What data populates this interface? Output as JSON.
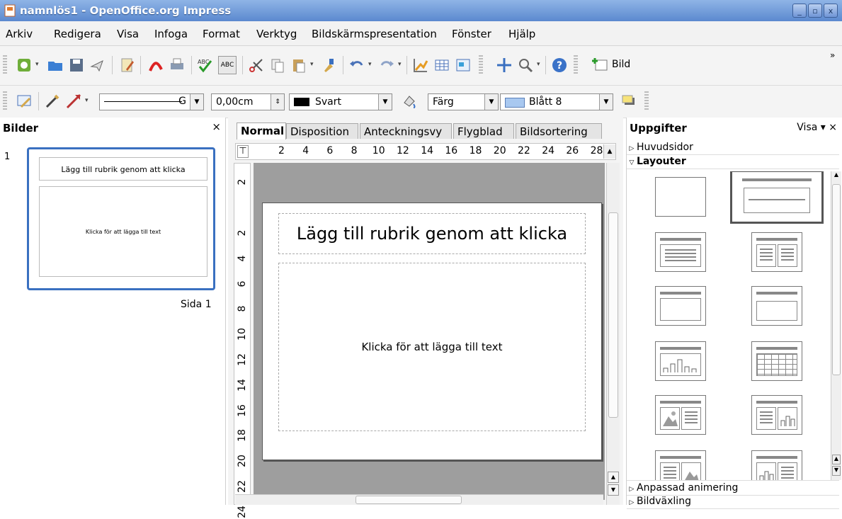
{
  "window": {
    "title": "namnlös1 - OpenOffice.org Impress"
  },
  "menu": [
    "Arkiv",
    "Redigera",
    "Visa",
    "Infoga",
    "Format",
    "Verktyg",
    "Bildskärmspresentation",
    "Fönster",
    "Hjälp"
  ],
  "toolbar": {
    "new_slide_label": "Bild",
    "overflow": "»"
  },
  "format_toolbar": {
    "line_style_value": "G",
    "line_width_value": "0,00cm",
    "line_color_value": "Svart",
    "area_style_value": "Färg",
    "area_color_value": "Blått 8",
    "line_color_swatch": "#000000",
    "area_color_swatch": "#a8c8f0"
  },
  "slides_pane": {
    "title": "Bilder",
    "close": "×",
    "slide_number": "1",
    "thumb_title": "Lägg till rubrik genom att klicka",
    "thumb_body": "Klicka för att lägga till text",
    "page_label": "Sida 1"
  },
  "view_tabs": [
    "Normal",
    "Disposition",
    "Anteckningsvy",
    "Flygblad",
    "Bildsortering"
  ],
  "ruler": {
    "h_ticks": [
      "2",
      "4",
      "6",
      "8",
      "10",
      "12",
      "14",
      "16",
      "18",
      "20",
      "22",
      "24",
      "26",
      "28"
    ],
    "v_ticks": [
      "2",
      "2",
      "4",
      "6",
      "8",
      "10",
      "12",
      "14",
      "16",
      "18",
      "20",
      "22",
      "24"
    ]
  },
  "slide": {
    "title_placeholder": "Lägg till rubrik genom att klicka",
    "body_placeholder": "Klicka för att lägga till text"
  },
  "task_pane": {
    "title": "Uppgifter",
    "view_menu": "Visa",
    "sections": [
      "Huvudsidor",
      "Layouter",
      "Anpassad animering",
      "Bildväxling"
    ]
  }
}
